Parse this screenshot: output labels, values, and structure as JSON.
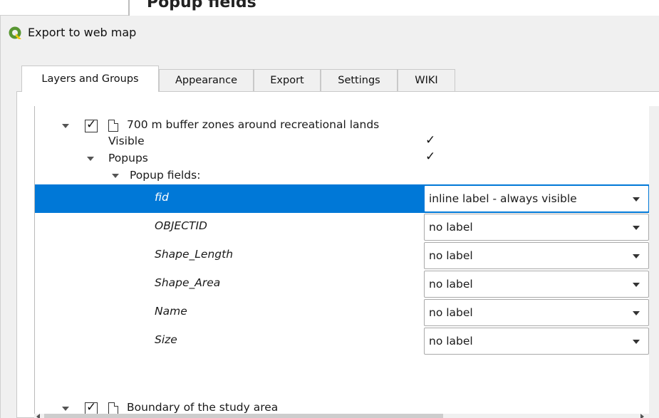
{
  "background_window": {
    "title": "Popup fields"
  },
  "window": {
    "title": "Export to web map",
    "icon": "qgis-logo-icon"
  },
  "tabs": [
    {
      "label": "Layers and Groups",
      "active": true
    },
    {
      "label": "Appearance",
      "active": false
    },
    {
      "label": "Export",
      "active": false
    },
    {
      "label": "Settings",
      "active": false
    },
    {
      "label": "WIKI",
      "active": false
    }
  ],
  "tree": {
    "layer1": {
      "name": "700 m buffer zones around recreational lands",
      "checked": true,
      "visible_label": "Visible",
      "visible_checked": true,
      "popups_label": "Popups",
      "popups_checked": true,
      "popup_fields_label": "Popup fields:",
      "fields": [
        {
          "name": "fid",
          "label_option": "inline label - always visible",
          "selected": true
        },
        {
          "name": "OBJECTID",
          "label_option": "no label",
          "selected": false
        },
        {
          "name": "Shape_Length",
          "label_option": "no label",
          "selected": false
        },
        {
          "name": "Shape_Area",
          "label_option": "no label",
          "selected": false
        },
        {
          "name": "Name",
          "label_option": "no label",
          "selected": false
        },
        {
          "name": "Size",
          "label_option": "no label",
          "selected": false
        }
      ]
    },
    "layer2": {
      "name": "Boundary of the study area",
      "checked": true
    }
  },
  "colors": {
    "selection": "#0078d7",
    "qgis_green": "#589632",
    "qgis_yellow": "#eec90d"
  }
}
